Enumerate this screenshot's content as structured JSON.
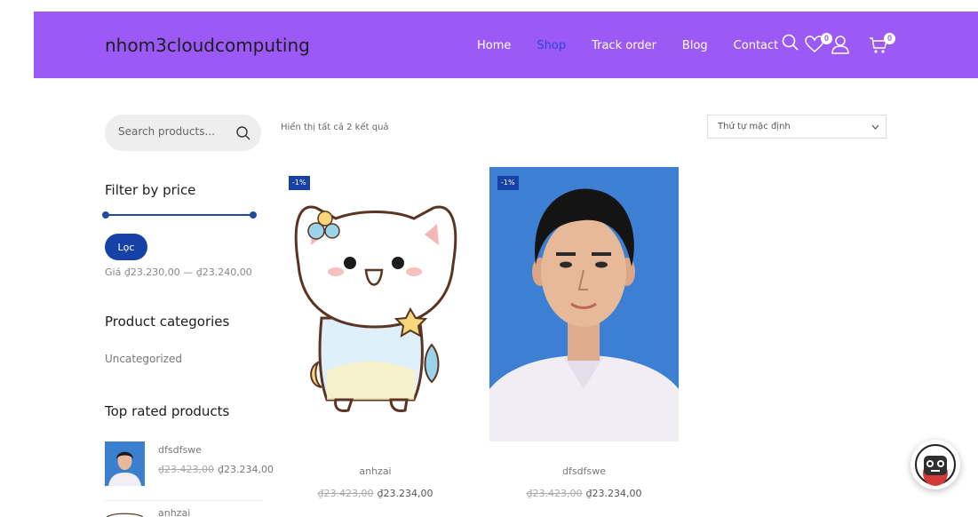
{
  "header": {
    "brand": "nhom3cloudcomputing",
    "nav": [
      "Home",
      "Shop",
      "Track order",
      "Blog",
      "Contact"
    ],
    "active_nav": "Shop",
    "wishlist_count": "0",
    "cart_count": "0",
    "bg_color": "#9b59f6"
  },
  "sidebar": {
    "search_placeholder": "Search products...",
    "filter_title": "Filter by price",
    "filter_button": "Lọc",
    "price_range": "Giá ₫23.230,00 — ₫23.240,00",
    "categories_title": "Product categories",
    "categories": [
      "Uncategorized"
    ],
    "top_rated_title": "Top rated products",
    "top_rated": [
      {
        "name": "dfsdfswe",
        "old_price": "₫23.423,00",
        "price": "₫23.234,00"
      },
      {
        "name": "anhzai"
      }
    ]
  },
  "shop": {
    "result_count": "Hiển thị tất cả 2 kết quả",
    "orderby": "Thứ tự mặc định",
    "products": [
      {
        "name": "anhzai",
        "sale": "-1%",
        "old_price": "₫23.423,00",
        "price": "₫23.234,00"
      },
      {
        "name": "dfsdfswe",
        "sale": "-1%",
        "old_price": "₫23.423,00",
        "price": "₫23.234,00"
      }
    ]
  },
  "icons": [
    "search-icon",
    "heart-icon",
    "user-icon",
    "cart-icon",
    "chevron-down-icon",
    "chat-bot-icon"
  ]
}
